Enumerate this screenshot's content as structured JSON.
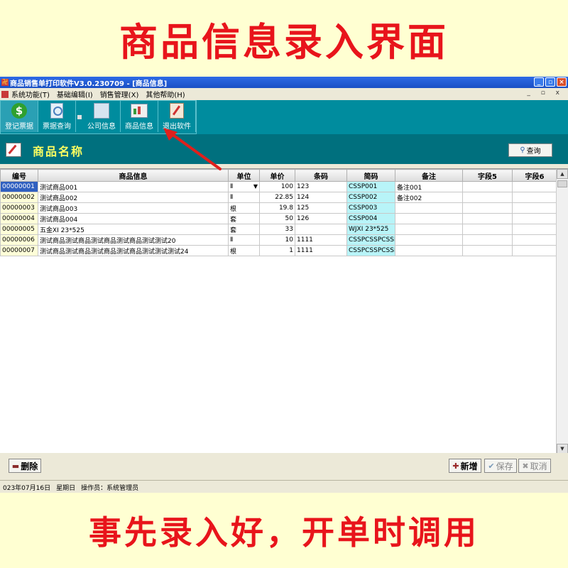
{
  "banner": {
    "top": "商品信息录入界面",
    "bottom": "事先录入好，开单时调用"
  },
  "window": {
    "title": "商品销售单打印软件V3.0.230709 - [商品信息]"
  },
  "menu": {
    "items": [
      "系统功能(T)",
      "基础编辑(I)",
      "销售管理(X)",
      "其他帮助(H)"
    ],
    "mdi": "_ ▫ x"
  },
  "toolbar": {
    "buttons": [
      {
        "label": "登记票据",
        "icon": "dollar-icon"
      },
      {
        "label": "票据查询",
        "icon": "search-document-icon"
      },
      {
        "label": "公司信息",
        "icon": "company-icon"
      },
      {
        "label": "商品信息",
        "icon": "goods-icon"
      },
      {
        "label": "退出软件",
        "icon": "exit-icon"
      }
    ]
  },
  "header": {
    "title": "商品名称",
    "query_label": "查询"
  },
  "grid": {
    "columns": [
      "编号",
      "商品信息",
      "单位",
      "单价",
      "条码",
      "简码",
      "备注",
      "字段5",
      "字段6"
    ],
    "rows": [
      [
        "00000001",
        "测试商品001",
        "Ⅱ",
        "100",
        "123",
        "CSSP001",
        "备注001",
        "",
        ""
      ],
      [
        "00000002",
        "测试商品002",
        "Ⅱ",
        "22.85",
        "124",
        "CSSP002",
        "备注002",
        "",
        ""
      ],
      [
        "00000003",
        "测试商品003",
        "根",
        "19.8",
        "125",
        "CSSP003",
        "",
        "",
        ""
      ],
      [
        "00000004",
        "测试商品004",
        "套",
        "50",
        "126",
        "CSSP004",
        "",
        "",
        ""
      ],
      [
        "00000005",
        "五金XI 23*525",
        "套",
        "33",
        "",
        "WJXI 23*525",
        "",
        "",
        ""
      ],
      [
        "00000006",
        "测试商品测试商品测试商品测试商品测试测试20",
        "Ⅱ",
        "10",
        "1111",
        "CSSPCSSPCSSPCS",
        "",
        "",
        ""
      ],
      [
        "00000007",
        "测试商品测试商品测试商品测试商品测试测试测试24",
        "根",
        "1",
        "1111",
        "CSSPCSSPCSSPCS",
        "",
        "",
        ""
      ]
    ]
  },
  "actions": {
    "delete": "删除",
    "add": "新增",
    "save": "保存",
    "cancel": "取消"
  },
  "status": {
    "date": "023年07月16日",
    "weekday": "星期日",
    "operator": "操作员：系统管理员"
  },
  "colors": {
    "banner_text": "#E8141B",
    "banner_bg": "#FFFFD2",
    "toolbar_bg": "#008C9E",
    "header_bg": "#00707E",
    "header_text": "#FFFF60",
    "abbr_bg": "#B8F4F8",
    "code_bg": "#FFFFD8",
    "arrow": "#E0201C"
  }
}
